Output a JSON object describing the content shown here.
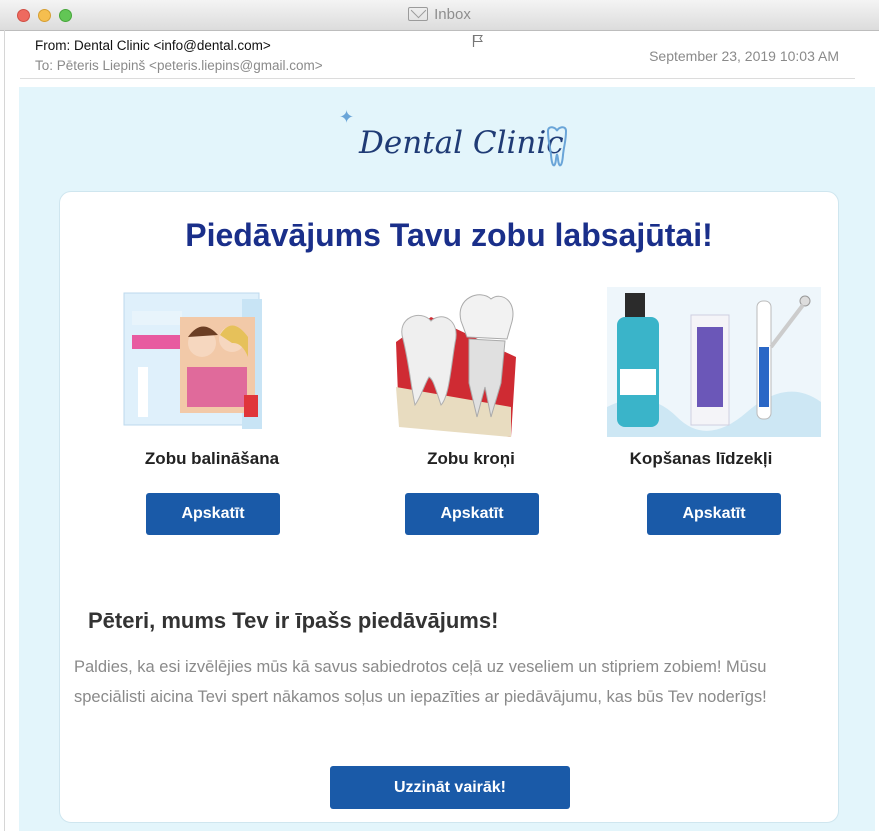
{
  "window": {
    "title": "Inbox"
  },
  "message": {
    "from": "From: Dental Clinic <info@dental.com>",
    "to": "To: Pēteris Liepinš <peteris.liepins@gmail.com>",
    "date": "September 23, 2019 10:03 AM",
    "flag_icon": "flag-icon"
  },
  "email": {
    "logo_text": "Dental Clinic",
    "headline": "Piedāvājums Tavu zobu labsajūtai!",
    "products": [
      {
        "name": "Zobu balināšana",
        "button": "Apskatīt",
        "image": "whitening-kit-image"
      },
      {
        "name": "Zobu kroņi",
        "button": "Apskatīt",
        "image": "tooth-crown-image"
      },
      {
        "name": "Kopšanas līdzekļi",
        "button": "Apskatīt",
        "image": "oral-care-products-image"
      }
    ],
    "subheading": "Pēteri, mums Tev ir īpašs piedāvājums!",
    "paragraph": "Paldies, ka esi izvēlējies mūs kā savus sabiedrotos ceļā uz veseliem un stipriem zobiem! Mūsu speciālisti aicina Tevi spert nākamos soļus un iepazīties ar piedāvājumu, kas būs Tev noderīgs!",
    "cta": "Uzzināt vairāk!"
  },
  "colors": {
    "email_background": "#e3f5fb",
    "headline": "#1a2f8a",
    "button": "#1a5aa8"
  }
}
